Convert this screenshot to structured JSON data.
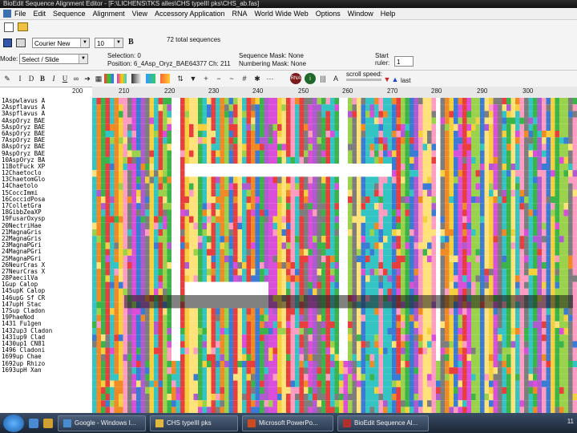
{
  "window": {
    "title": "BioEdit Sequence Alignment Editor - [F:\\LICHENS\\TKS alles\\CHS typeIII pks\\CHS_ab.fas]"
  },
  "menu": [
    "File",
    "Edit",
    "Sequence",
    "Alignment",
    "View",
    "Accessory Application",
    "RNA",
    "World Wide Web",
    "Options",
    "Window",
    "Help"
  ],
  "toolbar": {
    "font": "Courier New",
    "font_size": "10",
    "bold": "B",
    "seq_count": "72 total sequences",
    "mode": "Select / Slide",
    "mode_label": "Mode:",
    "selection": "Selection: 0",
    "position": "Position: 6_4Asp_Oryz_BAE64377 Ch: 211",
    "sequence_mask": "Sequence Mask: None",
    "numbering_mask": "Numbering Mask: None",
    "start_label": "Start",
    "ruler_label": "ruler:",
    "ruler_value": "1",
    "scroll_speed_label": "scroll speed:",
    "last_label": "last",
    "tools": [
      "I",
      "D",
      "B",
      "I",
      "U"
    ]
  },
  "ruler_ticks": [
    "200",
    "210",
    "220",
    "230",
    "240",
    "250",
    "260",
    "270",
    "280",
    "290",
    "300"
  ],
  "sequences": [
    "1Aspwlavus A",
    "2Aspflavus A",
    "3Aspflavus A",
    "4AspOryz BAE",
    "5AspOryz BAE",
    "6AspOryz BAE",
    "7AspOryz BAE",
    "8AspOryz BAE",
    "9AspOryz BAE",
    "10AspOryz BA",
    "11BotFuck XP",
    "12Chaetoclo",
    "13ChaetomGlo",
    "14Chaetolo",
    "15CoccImmi",
    "16CoccidPosa",
    "17ColletGra",
    "18GibbZeaXP",
    "19FusarOxysp",
    "20NectriHae",
    "21MagnaGris",
    "22MagnaGris",
    "23MagnaPGri",
    "24MagnaPGri",
    "25MagnaPGri",
    "26NeurCras X",
    "27NeurCras X",
    "28PaecilVa",
    "1Gup Calop",
    "145upK Calop",
    "146upG Sf CR",
    "147upH Stac",
    "17Sup Cladon",
    "19PhaeNod",
    "1431 Fu1gen",
    "1432up3 Cladon",
    "1431up9 Clad",
    "1430up1 CN81",
    "1496 Cladoni",
    "1699up Chae",
    "1692up Rhizo",
    "1693upH Xan"
  ],
  "taskbar": {
    "items": [
      "Google - Windows I...",
      "CHS typeIII pks",
      "Microsoft PowerPo...",
      "BioEdit Sequence Al..."
    ],
    "tray": "11"
  }
}
